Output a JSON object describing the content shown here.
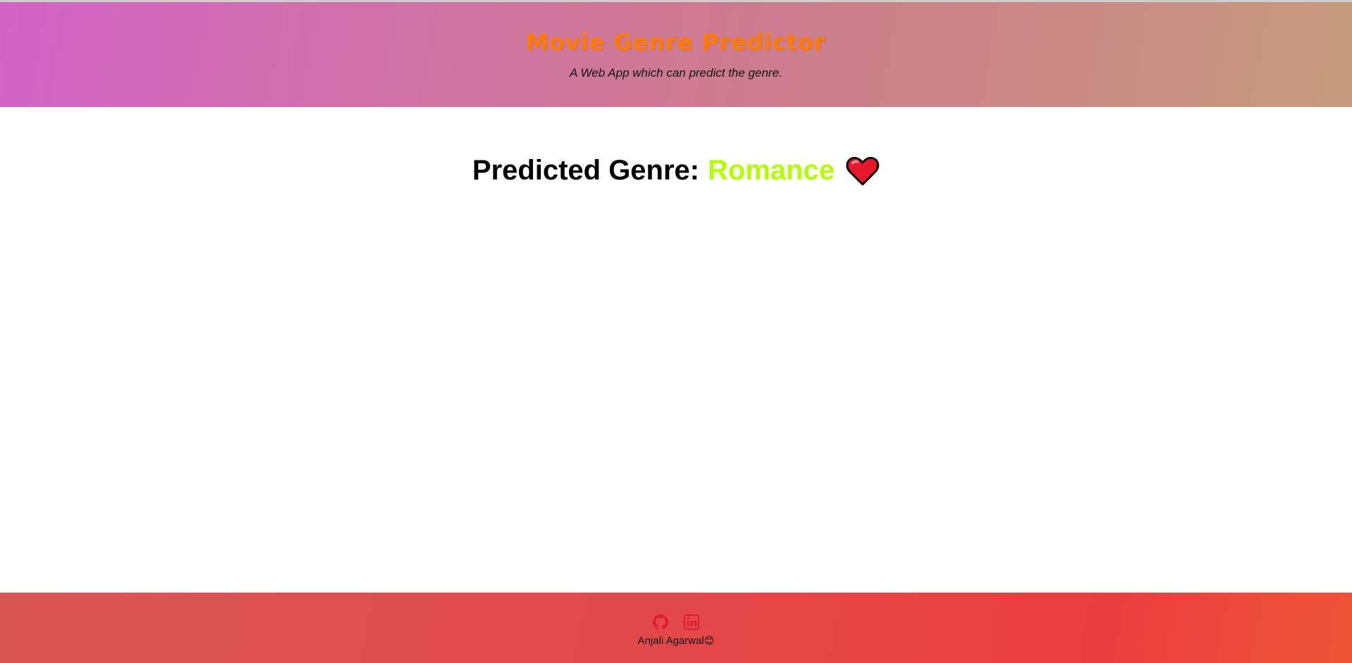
{
  "header": {
    "title": "Movie Genre Predictor",
    "subtitle": "A Web App which can predict the genre."
  },
  "result": {
    "label": "Predicted Genre:",
    "genre": "Romance",
    "genre_color": "#b3ff00",
    "icon": "heart-icon"
  },
  "footer": {
    "links": [
      {
        "icon": "github-icon"
      },
      {
        "icon": "linkedin-icon"
      }
    ],
    "author": "Anjali Agarwal",
    "author_emoji": "😊"
  },
  "colors": {
    "title": "#ff7a00",
    "footer_icons": "#e11d2b"
  }
}
